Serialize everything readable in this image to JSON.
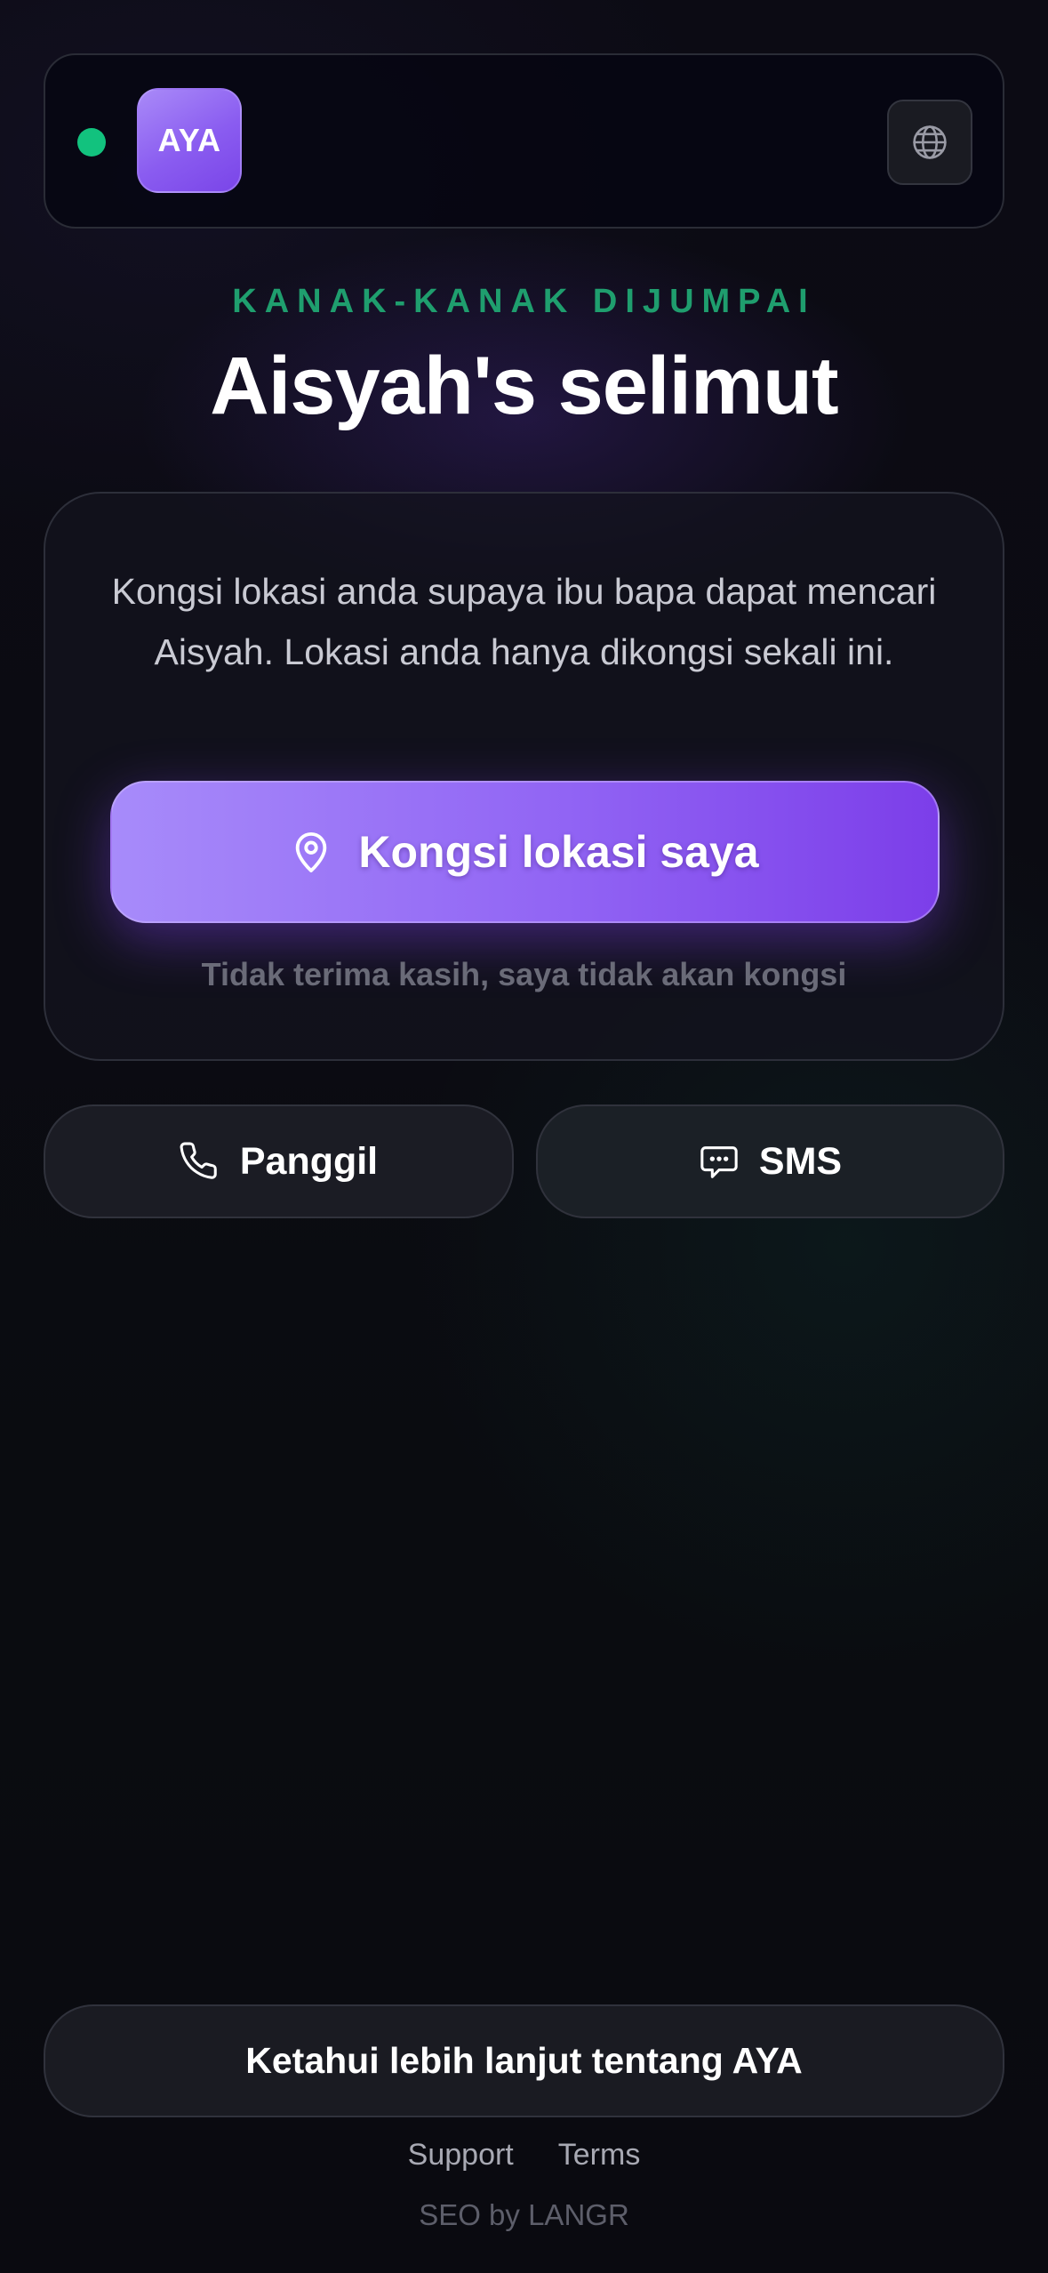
{
  "header": {
    "logo_text": "AYA",
    "status": "online",
    "language_icon": "globe-icon"
  },
  "hero": {
    "eyebrow": "KANAK-KANAK DIJUMPAI",
    "title": "Aisyah's selimut"
  },
  "share_card": {
    "description": "Kongsi lokasi anda supaya ibu bapa dapat mencari Aisyah. Lokasi anda hanya dikongsi sekali ini.",
    "share_button_label": "Kongsi lokasi saya",
    "share_button_icon": "map-pin-icon",
    "decline_label": "Tidak terima kasih, saya tidak akan kongsi"
  },
  "actions": {
    "call_label": "Panggil",
    "call_icon": "phone-icon",
    "sms_label": "SMS",
    "sms_icon": "message-icon"
  },
  "footer": {
    "learn_more_label": "Ketahui lebih lanjut tentang AYA",
    "support_label": "Support",
    "terms_label": "Terms",
    "credit": "SEO by LANGR"
  },
  "colors": {
    "accent_purple": "#8b5cf6",
    "status_green": "#12c27e",
    "eyebrow_green": "#1f9e6e",
    "background": "#0a0a10"
  }
}
